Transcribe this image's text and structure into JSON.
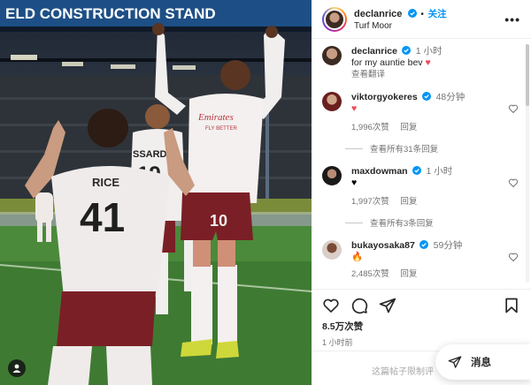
{
  "photo": {
    "stand_sign": "ELD CONSTRUCTION STAND",
    "player_front_name": "RICE",
    "player_front_number": "41",
    "player_center_sponsor": "Emirates\nFLY BETTER",
    "player_center_number": "10",
    "player_back_name": "SSARD",
    "player_back_number": "19"
  },
  "header": {
    "username": "declanrice",
    "follow_label": "关注",
    "location": "Turf Moor",
    "more_label": "•••"
  },
  "caption": {
    "username": "declanrice",
    "time": "1 小时",
    "text": "for my auntie bev",
    "emoji": "♥",
    "translate_label": "查看翻译"
  },
  "comments": [
    {
      "username": "viktorgyokeres",
      "time": "48分钟",
      "text": "♥",
      "text_color": "#ed4956",
      "likes": "1,996次赞",
      "reply_label": "回复",
      "view_replies": "查看所有31条回复"
    },
    {
      "username": "maxdowman",
      "time": "1 小时",
      "text": "♥",
      "text_color": "#000000",
      "likes": "1,997次赞",
      "reply_label": "回复",
      "view_replies": "查看所有3条回复"
    },
    {
      "username": "bukayosaka87",
      "time": "59分钟",
      "text": "🔥",
      "text_color": "#f77f00",
      "likes": "2,485次赞",
      "reply_label": "回复"
    }
  ],
  "actions": {
    "like_icon": "heart-outline-icon",
    "comment_icon": "comment-bubble-icon",
    "share_icon": "paper-plane-icon",
    "save_icon": "bookmark-icon",
    "likes_count": "8.5万次赞",
    "posted_ago": "1 小时前"
  },
  "footer": {
    "comments_disabled_note": "这篇帖子限制评",
    "message_label": "消息"
  },
  "colors": {
    "accent_blue": "#0095f6",
    "heart_red": "#ed4956",
    "kit_white": "#f1eeee",
    "kit_maroon": "#7b1f26"
  }
}
